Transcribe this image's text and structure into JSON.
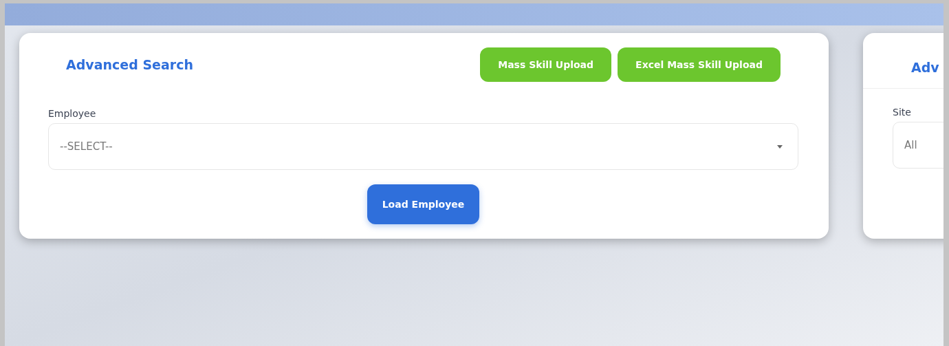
{
  "cards": [
    {
      "title": "Advanced Search",
      "buttons": [
        {
          "label": "Mass Skill Upload"
        },
        {
          "label": "Excel Mass Skill Upload"
        }
      ],
      "field": {
        "label": "Employee",
        "value": "--SELECT--"
      },
      "action": "Load Employee"
    },
    {
      "title": "Adv",
      "field": {
        "label": "Site",
        "value": "All"
      }
    }
  ]
}
